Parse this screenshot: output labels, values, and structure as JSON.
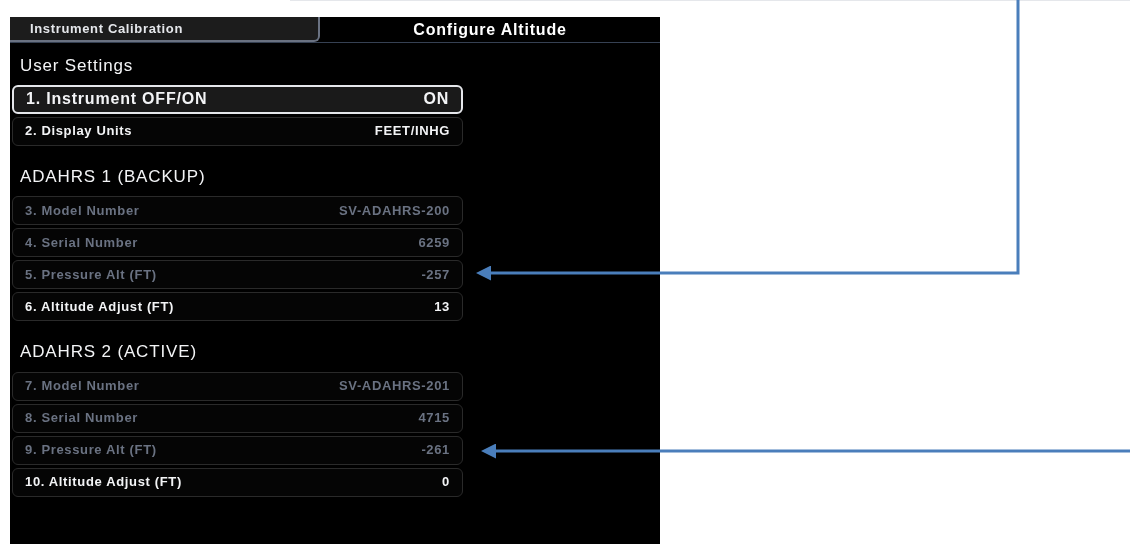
{
  "tabs": [
    {
      "label": "Instrument Calibration",
      "selected": false
    },
    {
      "label": "Configure Altitude",
      "selected": true
    }
  ],
  "sections": [
    {
      "title": "User Settings",
      "rows": [
        {
          "label": "1. Instrument OFF/ON",
          "value": "ON",
          "selected": true,
          "disabled": false
        },
        {
          "label": "2. Display Units",
          "value": "FEET/INHG",
          "selected": false,
          "disabled": false
        }
      ]
    },
    {
      "title": "ADAHRS 1 (BACKUP)",
      "rows": [
        {
          "label": "3. Model Number",
          "value": "SV-ADAHRS-200",
          "selected": false,
          "disabled": true
        },
        {
          "label": "4. Serial Number",
          "value": "6259",
          "selected": false,
          "disabled": true
        },
        {
          "label": "5. Pressure Alt (FT)",
          "value": "-257",
          "selected": false,
          "disabled": true
        },
        {
          "label": "6. Altitude Adjust (FT)",
          "value": "13",
          "selected": false,
          "disabled": false
        }
      ]
    },
    {
      "title": "ADAHRS 2 (ACTIVE)",
      "rows": [
        {
          "label": "7. Model Number",
          "value": "SV-ADAHRS-201",
          "selected": false,
          "disabled": true
        },
        {
          "label": "8. Serial Number",
          "value": "4715",
          "selected": false,
          "disabled": true
        },
        {
          "label": "9. Pressure Alt (FT)",
          "value": "-261",
          "selected": false,
          "disabled": true
        },
        {
          "label": "10. Altitude Adjust (FT)",
          "value": "0",
          "selected": false,
          "disabled": false
        }
      ]
    }
  ]
}
